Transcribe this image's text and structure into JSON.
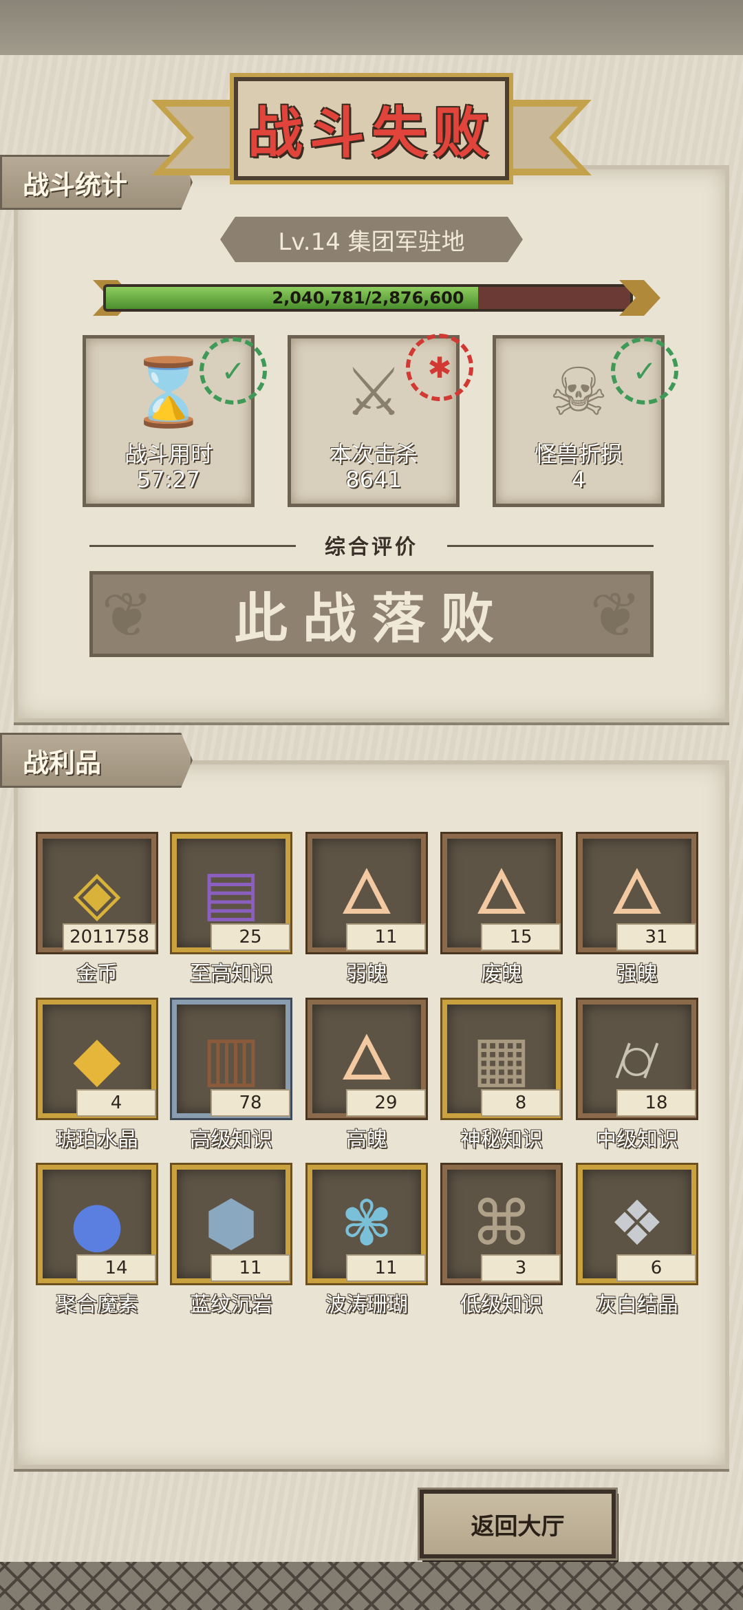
{
  "title": "战斗失败",
  "stats_section": {
    "tag": "战斗统计",
    "level_label": "Lv.14 集团军驻地",
    "progress": {
      "current": 2040781,
      "max": 2876600,
      "text": "2,040,781/2,876,600"
    },
    "cards": [
      {
        "label": "战斗用时",
        "value": "57:27",
        "icon": "hourglass-icon",
        "stamp": "green"
      },
      {
        "label": "本次击杀",
        "value": "8641",
        "icon": "crossed-swords-icon",
        "stamp": "red"
      },
      {
        "label": "怪兽折损",
        "value": "4",
        "icon": "skull-icon",
        "stamp": "green"
      }
    ],
    "evaluation_label": "综合评价",
    "verdict": "此战落败"
  },
  "loot_section": {
    "tag": "战利品",
    "items": [
      {
        "name": "金币",
        "count": "2011758",
        "icon": "gold-coin-icon",
        "frame": "bronze"
      },
      {
        "name": "至高知识",
        "count": "25",
        "icon": "purple-book-icon",
        "frame": "gold"
      },
      {
        "name": "弱魄",
        "count": "11",
        "icon": "flame-icon",
        "frame": "bronze"
      },
      {
        "name": "废魄",
        "count": "15",
        "icon": "flame-icon",
        "frame": "bronze"
      },
      {
        "name": "强魄",
        "count": "31",
        "icon": "flame-icon",
        "frame": "bronze"
      },
      {
        "name": "琥珀水晶",
        "count": "4",
        "icon": "amber-crystal-icon",
        "frame": "gold"
      },
      {
        "name": "高级知识",
        "count": "78",
        "icon": "tied-book-icon",
        "frame": "silver"
      },
      {
        "name": "高魄",
        "count": "29",
        "icon": "flame-icon",
        "frame": "bronze"
      },
      {
        "name": "神秘知识",
        "count": "8",
        "icon": "stone-tablet-icon",
        "frame": "gold"
      },
      {
        "name": "中级知识",
        "count": "18",
        "icon": "scroll-icon",
        "frame": "bronze"
      },
      {
        "name": "聚合魔素",
        "count": "14",
        "icon": "blue-orb-icon",
        "frame": "gold"
      },
      {
        "name": "蓝纹沉岩",
        "count": "11",
        "icon": "blue-rock-icon",
        "frame": "gold"
      },
      {
        "name": "波涛珊瑚",
        "count": "11",
        "icon": "coral-icon",
        "frame": "gold"
      },
      {
        "name": "低级知识",
        "count": "3",
        "icon": "rolled-scroll-icon",
        "frame": "bronze"
      },
      {
        "name": "灰白结晶",
        "count": "6",
        "icon": "grey-crystal-icon",
        "frame": "gold"
      }
    ]
  },
  "return_button": "返回大厅"
}
